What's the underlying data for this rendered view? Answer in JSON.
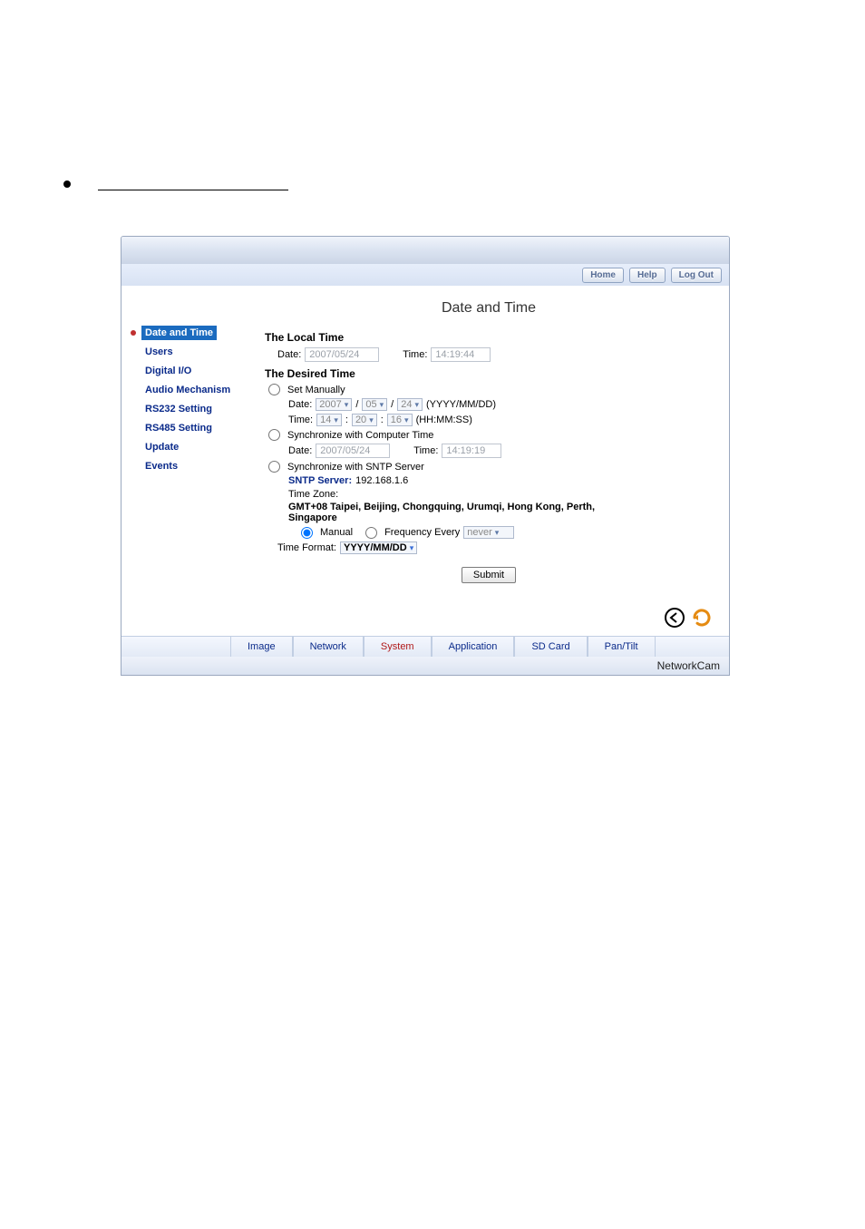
{
  "nav": {
    "home": "Home",
    "help": "Help",
    "logout": "Log Out"
  },
  "title": "Date and Time",
  "sidebar": [
    {
      "label": "Date and Time",
      "active": true
    },
    {
      "label": "Users"
    },
    {
      "label": "Digital I/O"
    },
    {
      "label": "Audio Mechanism"
    },
    {
      "label": "RS232 Setting"
    },
    {
      "label": "RS485 Setting"
    },
    {
      "label": "Update"
    },
    {
      "label": "Events"
    }
  ],
  "local": {
    "heading": "The Local Time",
    "date_label": "Date:",
    "date_value": "2007/05/24",
    "time_label": "Time:",
    "time_value": "14:19:44"
  },
  "desired": {
    "heading": "The Desired Time",
    "set_manually": "Set Manually",
    "manual": {
      "date_label": "Date:",
      "yyyy": "2007",
      "mm": "05",
      "dd": "24",
      "date_hint": "(YYYY/MM/DD)",
      "time_label": "Time:",
      "hh": "14",
      "mi": "20",
      "ss": "16",
      "time_hint": "(HH:MM:SS)"
    },
    "sync_computer": "Synchronize with Computer Time",
    "computer": {
      "date_label": "Date:",
      "date_value": "2007/05/24",
      "time_label": "Time:",
      "time_value": "14:19:19"
    },
    "sync_sntp": "Synchronize with SNTP Server",
    "sntp": {
      "server_label": "SNTP Server:",
      "server_value": "192.168.1.6",
      "tz_label": "Time Zone:",
      "tz_value": "GMT+08 Taipei, Beijing, Chongquing, Urumqi, Hong Kong, Perth, Singapore",
      "mode_manual": "Manual",
      "mode_freq": "Frequency Every",
      "freq_value": "never"
    },
    "time_format_label": "Time Format:",
    "time_format_value": "YYYY/MM/DD"
  },
  "submit": "Submit",
  "tabs": [
    "Image",
    "Network",
    "System",
    "Application",
    "SD Card",
    "Pan/Tilt"
  ],
  "tabs_active": 2,
  "brand": "NetworkCam"
}
